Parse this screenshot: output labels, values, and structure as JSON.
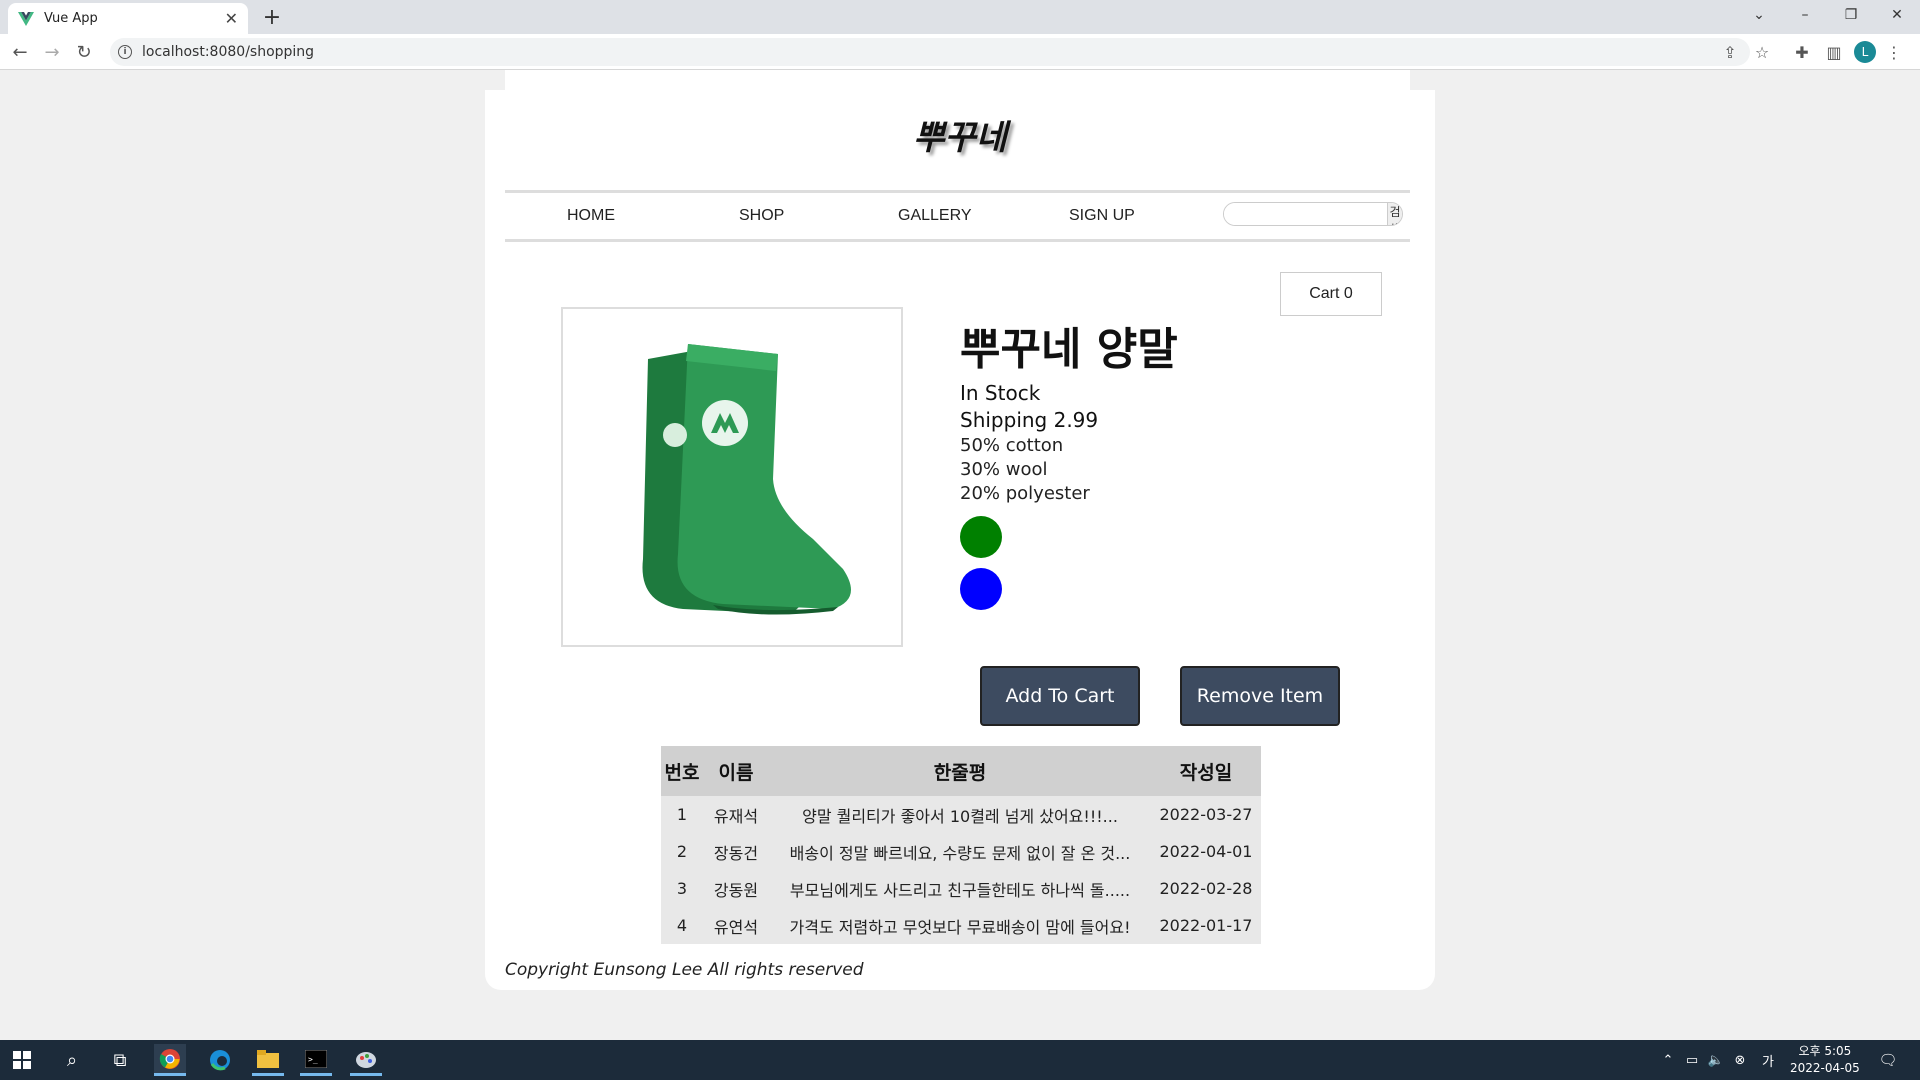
{
  "browser": {
    "tab_title": "Vue App",
    "url": "localhost:8080/shopping",
    "profile_initial": "L"
  },
  "site": {
    "logo": "뿌꾸네",
    "nav": [
      "HOME",
      "SHOP",
      "GALLERY",
      "SIGN UP"
    ],
    "search_button": "검색",
    "search_placeholder": "",
    "cart_label": "Cart 0"
  },
  "product": {
    "name": "뿌꾸네 양말",
    "stock": "In Stock",
    "shipping": "Shipping 2.99",
    "details": [
      "50% cotton",
      "30% wool",
      "20% polyester"
    ],
    "variant_colors": [
      "#008000",
      "#0000ff"
    ],
    "add_button": "Add To Cart",
    "remove_button": "Remove Item"
  },
  "reviews": {
    "headers": [
      "번호",
      "이름",
      "한줄평",
      "작성일"
    ],
    "rows": [
      [
        "1",
        "유재석",
        "양말 퀄리티가 좋아서 10켤레 넘게 샀어요!!!...",
        "2022-03-27"
      ],
      [
        "2",
        "장동건",
        "배송이 정말 빠르네요, 수량도 문제 없이 잘 온 것...",
        "2022-04-01"
      ],
      [
        "3",
        "강동원",
        "부모님에게도 사드리고 친구들한테도 하나씩 돌.....",
        "2022-02-28"
      ],
      [
        "4",
        "유연석",
        "가격도 저렴하고 무엇보다 무료배송이 맘에 들어요!",
        "2022-01-17"
      ]
    ]
  },
  "footer": {
    "copyright": "Copyright Eunsong Lee All rights reserved"
  },
  "taskbar": {
    "time": "오후 5:05",
    "date": "2022-04-05"
  }
}
